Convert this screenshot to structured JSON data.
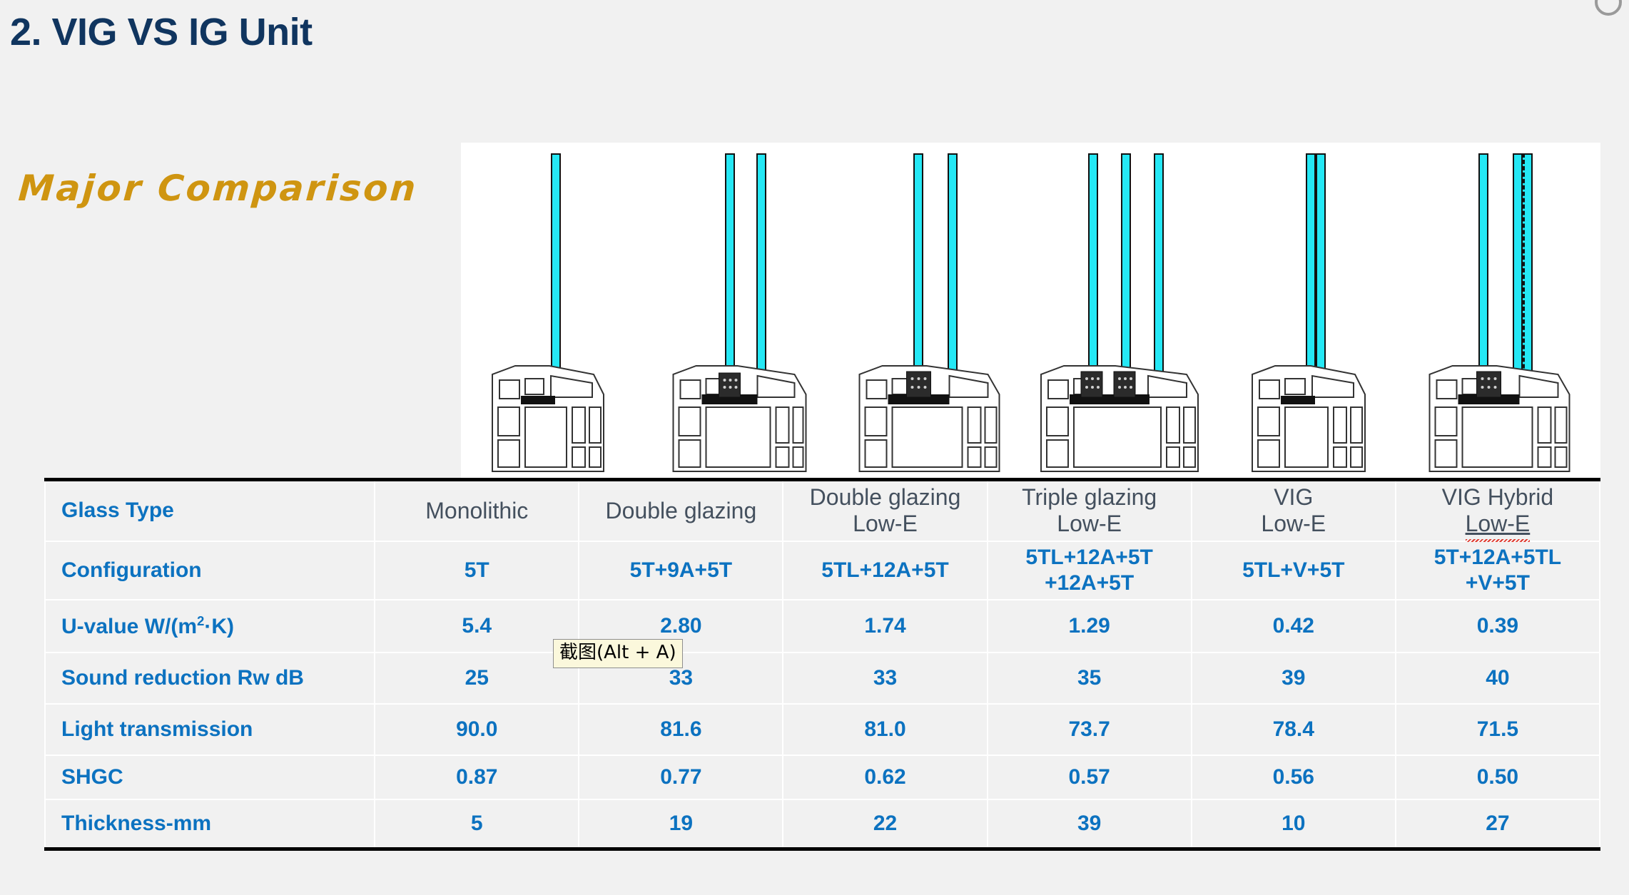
{
  "slide": {
    "title": "2. VIG VS IG Unit",
    "subtitle": "Major Comparison",
    "title_color": "#10355f",
    "subtitle_color": "#cf9511",
    "background_color": "#f1f1f1"
  },
  "tooltip": {
    "text": "截图(Alt + A)",
    "background": "#fbf8dc",
    "border": "#8f8f8f"
  },
  "diagram": {
    "panel_background": "#ffffff",
    "glass_color": "#25e8f5",
    "spacer_color": "#1b1b1b",
    "units": [
      {
        "name": "monolithic",
        "panes": 1,
        "label": "Monolithic"
      },
      {
        "name": "double-glazing",
        "panes": 2,
        "label": "Double glazing"
      },
      {
        "name": "double-glazing-low-e",
        "panes": 2,
        "label": "Double glazing Low-E"
      },
      {
        "name": "triple-glazing-low-e",
        "panes": 3,
        "label": "Triple glazing Low-E"
      },
      {
        "name": "vig-low-e",
        "panes": 2,
        "label": "VIG Low-E"
      },
      {
        "name": "vig-hybrid-low-e",
        "panes": 3,
        "label": "VIG Hybrid Low-E"
      }
    ]
  },
  "table": {
    "label_column_header": "Glass Type",
    "accent_color": "#0c72c0",
    "header_text_color": "#44505e",
    "cell_background": "#f1f1f1",
    "columns": [
      {
        "line1": "Monolithic",
        "line2": "",
        "spell_error": false
      },
      {
        "line1": "Double glazing",
        "line2": "",
        "spell_error": false
      },
      {
        "line1": "Double glazing",
        "line2": "Low-E",
        "spell_error": false
      },
      {
        "line1": "Triple glazing",
        "line2": "Low-E",
        "spell_error": false
      },
      {
        "line1": "VIG",
        "line2": "Low-E",
        "spell_error": false
      },
      {
        "line1": "VIG Hybrid",
        "line2": "Low-E",
        "spell_error": true
      }
    ],
    "rows": [
      {
        "label": "Configuration",
        "label_html": "Configuration",
        "values": [
          "5T",
          "5T+9A+5T",
          "5TL+12A+5T",
          "5TL+12A+5T\n+12A+5T",
          "5TL+V+5T",
          "5T+12A+5TL\n+V+5T"
        ]
      },
      {
        "label": "U-value W/(㎡·K)",
        "label_html": "U-value W/(m<sup>2</sup>·K)",
        "values": [
          "5.4",
          "2.80",
          "1.74",
          "1.29",
          "0.42",
          "0.39"
        ]
      },
      {
        "label": "Sound reduction Rw dB",
        "label_html": "Sound reduction Rw dB",
        "values": [
          "25",
          "33",
          "33",
          "35",
          "39",
          "40"
        ]
      },
      {
        "label": "Light transmission",
        "label_html": "Light transmission",
        "values": [
          "90.0",
          "81.6",
          "81.0",
          "73.7",
          "78.4",
          "71.5"
        ]
      },
      {
        "label": "SHGC",
        "label_html": "SHGC",
        "values": [
          "0.87",
          "0.77",
          "0.62",
          "0.57",
          "0.56",
          "0.50"
        ]
      },
      {
        "label": "Thickness-mm",
        "label_html": "Thickness-mm",
        "values": [
          "5",
          "19",
          "22",
          "39",
          "10",
          "27"
        ]
      }
    ]
  }
}
